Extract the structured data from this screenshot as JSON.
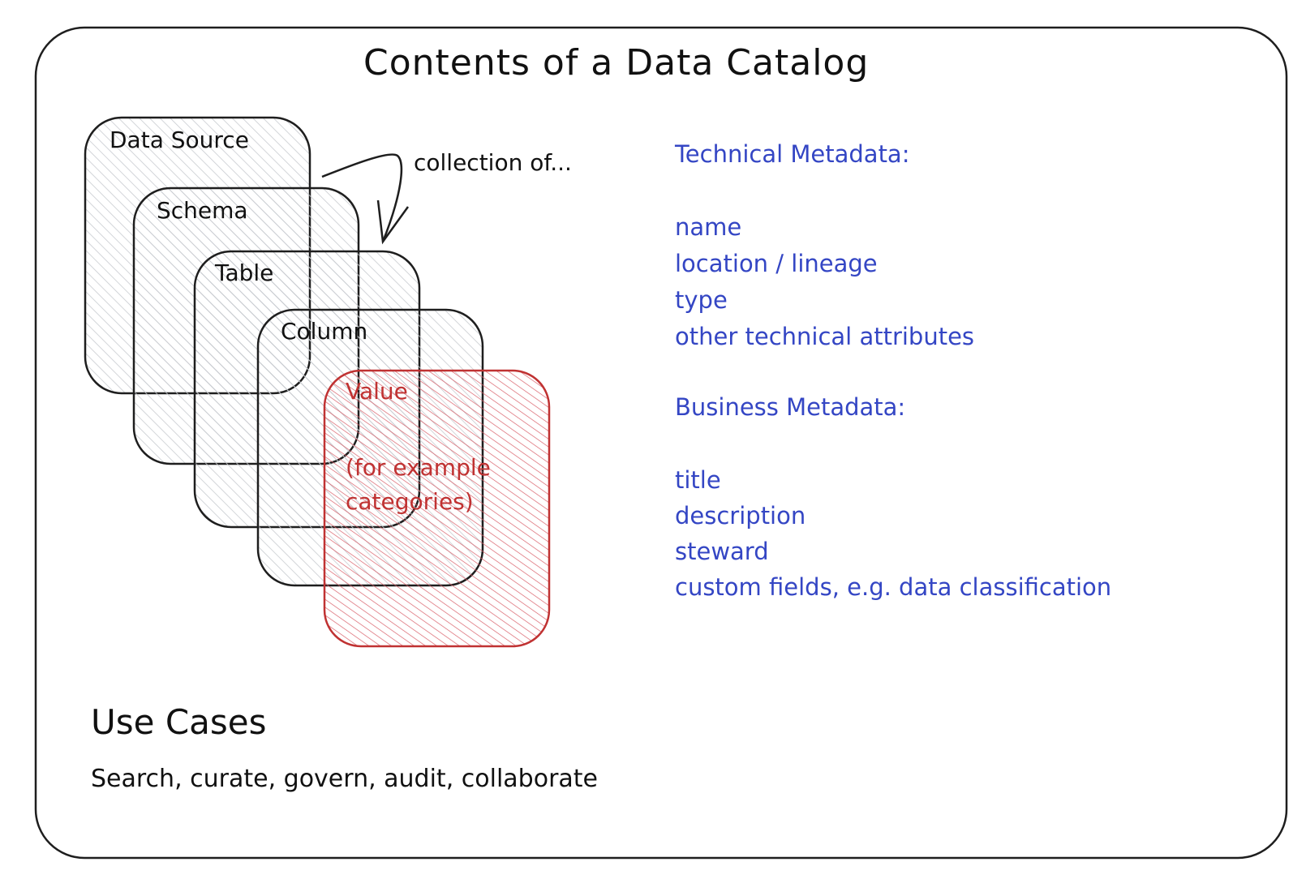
{
  "title": "Contents of a Data Catalog",
  "hierarchy": {
    "annotation": "collection of...",
    "levels": [
      {
        "label": "Data Source",
        "color": "#1e1e1e"
      },
      {
        "label": "Schema",
        "color": "#1e1e1e"
      },
      {
        "label": "Table",
        "color": "#1e1e1e"
      },
      {
        "label": "Column",
        "color": "#1e1e1e"
      },
      {
        "label": "Value",
        "sublabel_line1": "(for example",
        "sublabel_line2": "categories)",
        "color": "#c03232"
      }
    ]
  },
  "technical_metadata": {
    "heading": "Technical Metadata:",
    "items": [
      "name",
      "location / lineage",
      "type",
      "other technical attributes"
    ]
  },
  "business_metadata": {
    "heading": "Business Metadata:",
    "items": [
      "title",
      "description",
      "steward",
      "custom fields, e.g. data classification"
    ]
  },
  "use_cases": {
    "heading": "Use Cases",
    "text": "Search, curate, govern, audit, collaborate"
  },
  "colors": {
    "ink": "#1e1e1e",
    "metadata_blue": "#3446c4",
    "value_red": "#c03232",
    "hatch_gray": "#c8cbd0"
  }
}
